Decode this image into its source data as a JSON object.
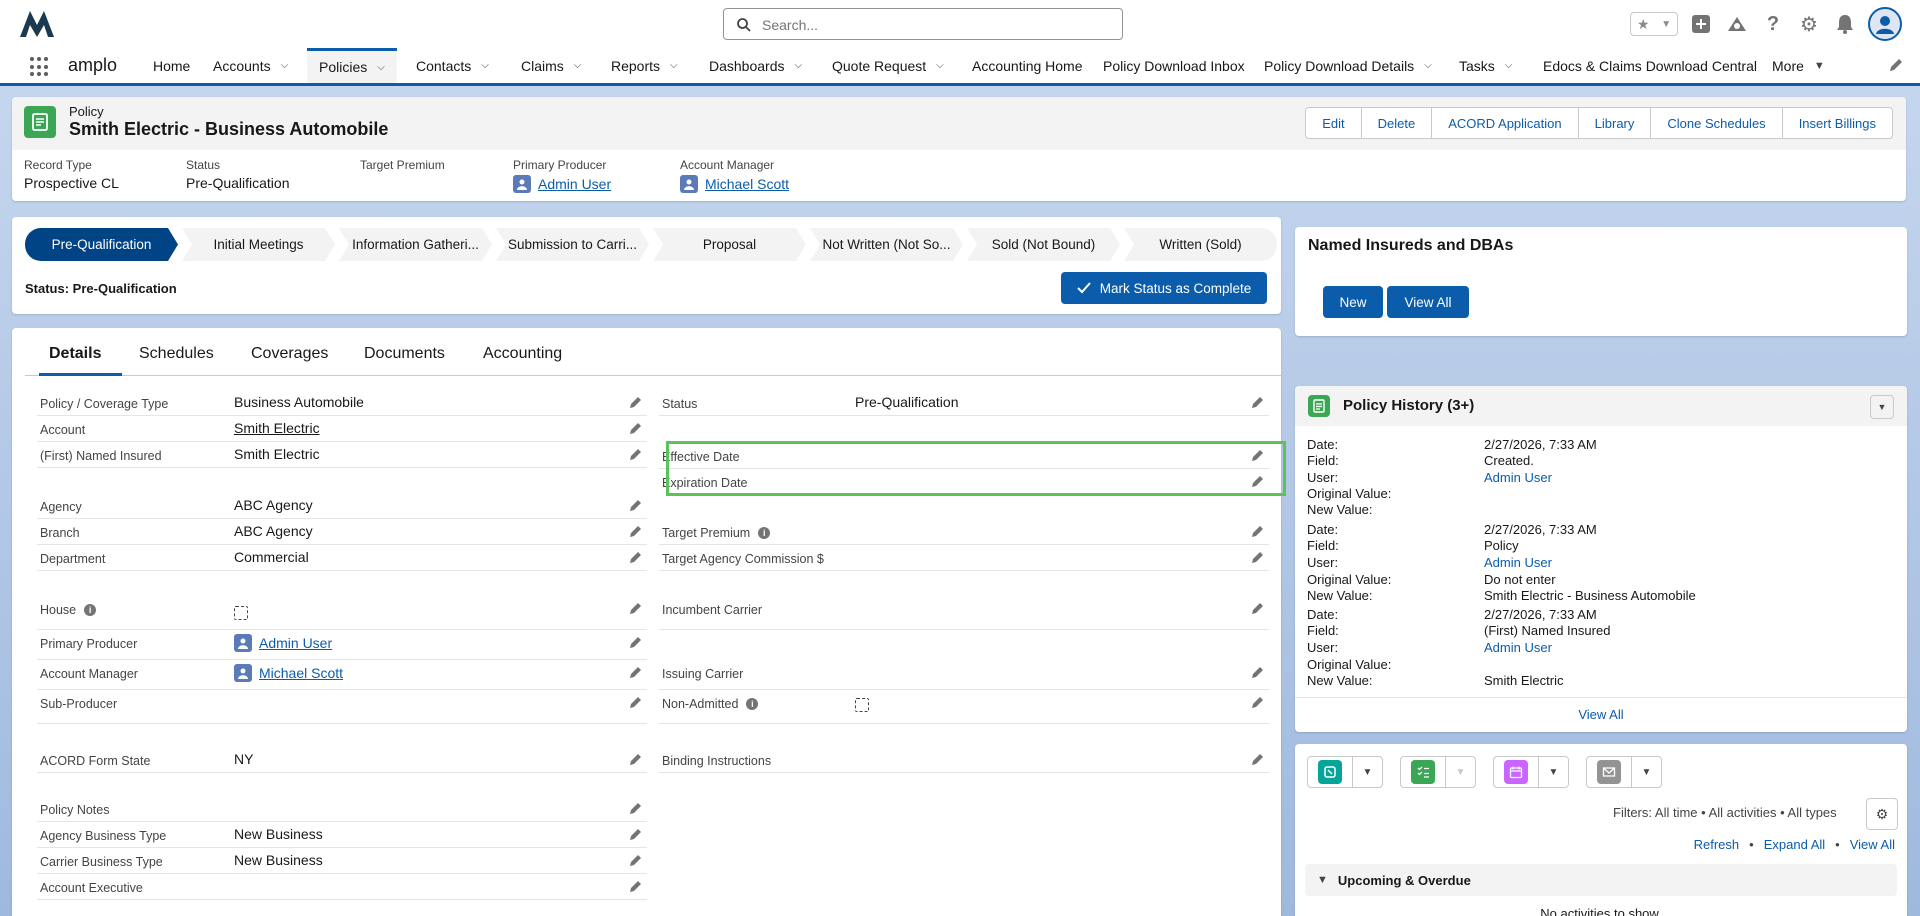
{
  "header": {
    "search_placeholder": "Search...",
    "app_name": "amplo"
  },
  "nav": {
    "items": [
      {
        "label": "Home"
      },
      {
        "label": "Accounts"
      },
      {
        "label": "Policies"
      },
      {
        "label": "Contacts"
      },
      {
        "label": "Claims"
      },
      {
        "label": "Reports"
      },
      {
        "label": "Dashboards"
      },
      {
        "label": "Quote Request"
      },
      {
        "label": "Accounting Home"
      },
      {
        "label": "Policy Download Inbox"
      },
      {
        "label": "Policy Download Details"
      },
      {
        "label": "Tasks"
      },
      {
        "label": "Edocs & Claims Download Central"
      },
      {
        "label": "More"
      }
    ]
  },
  "record": {
    "object_type": "Policy",
    "title": "Smith Electric - Business Automobile",
    "actions": [
      "Edit",
      "Delete",
      "ACORD Application",
      "Library",
      "Clone Schedules",
      "Insert Billings"
    ],
    "highlights": {
      "record_type_label": "Record Type",
      "record_type": "Prospective CL",
      "status_label": "Status",
      "status": "Pre-Qualification",
      "target_premium_label": "Target Premium",
      "primary_producer_label": "Primary Producer",
      "primary_producer": "Admin User",
      "account_manager_label": "Account Manager",
      "account_manager": "Michael Scott"
    }
  },
  "path": {
    "stages": [
      "Pre-Qualification",
      "Initial Meetings",
      "Information Gatheri...",
      "Submission to Carri...",
      "Proposal",
      "Not Written (Not So...",
      "Sold (Not Bound)",
      "Written (Sold)"
    ],
    "current_index": 0,
    "status_text": "Status: Pre-Qualification",
    "mark_complete": "Mark Status as Complete"
  },
  "tabs": [
    "Details",
    "Schedules",
    "Coverages",
    "Documents",
    "Accounting"
  ],
  "details": {
    "left": [
      {
        "label": "Policy / Coverage Type",
        "value": "Business Automobile"
      },
      {
        "label": "Account",
        "value": "Smith Electric"
      },
      {
        "label": "(First) Named Insured",
        "value": "Smith Electric"
      },
      {
        "label": "Agency",
        "value": "ABC Agency"
      },
      {
        "label": "Branch",
        "value": "ABC Agency"
      },
      {
        "label": "Department",
        "value": "Commercial"
      },
      {
        "label": "House",
        "value": ""
      },
      {
        "label": "Primary Producer",
        "value": "Admin User"
      },
      {
        "label": "Account Manager",
        "value": "Michael Scott"
      },
      {
        "label": "Sub-Producer",
        "value": ""
      },
      {
        "label": "ACORD Form State",
        "value": "NY"
      },
      {
        "label": "Policy Notes",
        "value": ""
      },
      {
        "label": "Agency Business Type",
        "value": "New Business"
      },
      {
        "label": "Carrier Business Type",
        "value": "New Business"
      },
      {
        "label": "Account Executive",
        "value": ""
      }
    ],
    "right": [
      {
        "label": "Status",
        "value": "Pre-Qualification"
      },
      {
        "label": "Effective Date",
        "value": ""
      },
      {
        "label": "Expiration Date",
        "value": ""
      },
      {
        "label": "Target Premium",
        "value": ""
      },
      {
        "label": "Target Agency Commission $",
        "value": ""
      },
      {
        "label": "Incumbent Carrier",
        "value": ""
      },
      {
        "label": "Issuing Carrier",
        "value": ""
      },
      {
        "label": "Non-Admitted",
        "value": ""
      },
      {
        "label": "Binding Instructions",
        "value": ""
      }
    ]
  },
  "named_insureds": {
    "title": "Named Insureds and DBAs",
    "new_label": "New",
    "view_all_label": "View All"
  },
  "history": {
    "title": "Policy History (3+)",
    "labels": {
      "date": "Date:",
      "field": "Field:",
      "user": "User:",
      "original": "Original Value:",
      "new": "New Value:"
    },
    "entries": [
      {
        "date": "2/27/2026, 7:33 AM",
        "field": "Created.",
        "user": "Admin User",
        "original": "",
        "new": ""
      },
      {
        "date": "2/27/2026, 7:33 AM",
        "field": "Policy",
        "user": "Admin User",
        "original": "Do not enter",
        "new": "Smith Electric - Business Automobile"
      },
      {
        "date": "2/27/2026, 7:33 AM",
        "field": "(First) Named Insured",
        "user": "Admin User",
        "original": "",
        "new": "Smith Electric"
      }
    ],
    "view_all": "View All"
  },
  "activity": {
    "filters": "Filters: All time • All activities • All types",
    "refresh": "Refresh",
    "expand_all": "Expand All",
    "view_all": "View All",
    "upcoming": "Upcoming & Overdue",
    "no_activities": "No activities to show."
  },
  "colors": {
    "brand": "#0b5cab",
    "path_current": "#014486",
    "policy_icon": "#3ba755",
    "highlight_box": "#5cc35a"
  }
}
